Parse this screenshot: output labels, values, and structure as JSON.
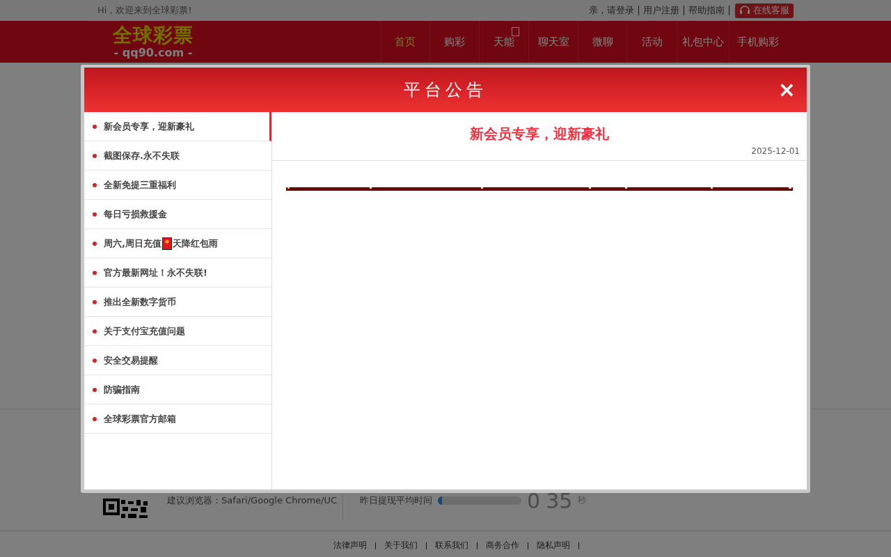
{
  "top_bar": {
    "welcome": "Hi，欢迎来到全球彩票!",
    "links": [
      "亲，请登录",
      "用户注册",
      "帮助指南"
    ],
    "service_button": "在线客服"
  },
  "header": {
    "logo_title": "全球彩票",
    "logo_domain": "- qq90.com -",
    "nav": [
      {
        "label": "首页",
        "selected": true,
        "badge": false
      },
      {
        "label": "购彩",
        "selected": false,
        "badge": false
      },
      {
        "label": "天能",
        "selected": false,
        "badge": true
      },
      {
        "label": "聊天室",
        "selected": false,
        "badge": false
      },
      {
        "label": "微聊",
        "selected": false,
        "badge": false
      },
      {
        "label": "活动",
        "selected": false,
        "badge": false
      },
      {
        "label": "礼包中心",
        "selected": false,
        "badge": false
      },
      {
        "label": "手机购彩",
        "selected": false,
        "badge": false
      }
    ]
  },
  "info_row": {
    "browser_hint": "建议浏览器：Safari/Google Chrome/UC",
    "withdraw_label": "昨日提现平均时间",
    "level": 0.05,
    "digits": [
      "0",
      "35"
    ],
    "unit": "秒"
  },
  "footer_links": [
    "法律声明",
    "关于我们",
    "联系我们",
    "商务合作",
    "隐私声明"
  ],
  "modal": {
    "title": "平台公告",
    "close": "×",
    "items": [
      {
        "kind": "text",
        "label": "新会员专享，迎新豪礼",
        "selected": true
      },
      {
        "kind": "text",
        "label": "截图保存.永不失联",
        "selected": false
      },
      {
        "kind": "text",
        "label": "全新免提三重福利",
        "selected": false
      },
      {
        "kind": "text",
        "label": "每日亏损救援金",
        "selected": false
      },
      {
        "kind": "with-icon",
        "label": "周六,周日充值",
        "label_after": "天降红包雨",
        "selected": false
      },
      {
        "kind": "text",
        "label": "官方最新网址！永不失联!",
        "selected": false
      },
      {
        "kind": "text",
        "label": "推出全新数字货币",
        "selected": false
      },
      {
        "kind": "text",
        "label": "关于支付宝充值问题",
        "selected": false
      },
      {
        "kind": "text",
        "label": "安全交易提醒",
        "selected": false
      },
      {
        "kind": "text",
        "label": "防骗指南",
        "selected": false
      },
      {
        "kind": "text",
        "label": "全球彩票官方邮箱",
        "selected": false
      }
    ],
    "content": {
      "heading": "新会员专享，迎新豪礼",
      "date": "2025-12-01"
    }
  }
}
